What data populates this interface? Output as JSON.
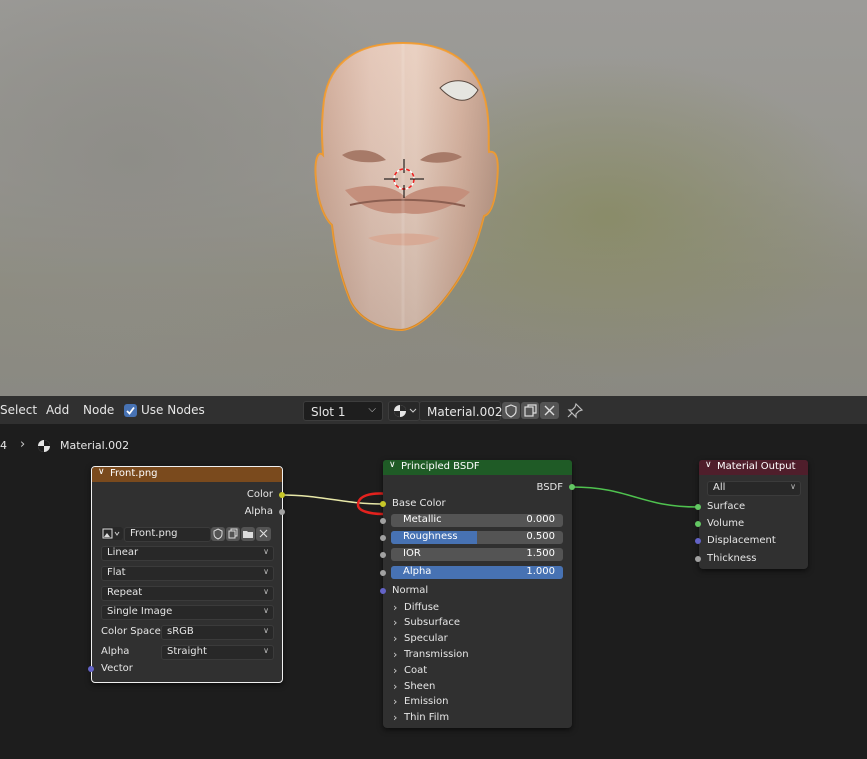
{
  "menu": {
    "select": "Select",
    "add": "Add",
    "node": "Node",
    "use_nodes": "Use Nodes"
  },
  "slot": {
    "value": "Slot 1"
  },
  "material": {
    "name": "Material.002"
  },
  "breadcrumb": {
    "prefix": "4",
    "material": "Material.002"
  },
  "image_node": {
    "title": "Front.png",
    "outputs": {
      "color": "Color",
      "alpha": "Alpha"
    },
    "image_name": "Front.png",
    "interpolation": "Linear",
    "projection": "Flat",
    "extension": "Repeat",
    "source": "Single Image",
    "color_space_label": "Color Space",
    "color_space_value": "sRGB",
    "alpha_label": "Alpha",
    "alpha_value": "Straight",
    "vector_label": "Vector"
  },
  "bsdf_node": {
    "title": "Principled BSDF",
    "output": "BSDF",
    "base_color": "Base Color",
    "metallic": {
      "label": "Metallic",
      "value": "0.000"
    },
    "roughness": {
      "label": "Roughness",
      "value": "0.500",
      "fill": 0.5
    },
    "ior": {
      "label": "IOR",
      "value": "1.500"
    },
    "alpha": {
      "label": "Alpha",
      "value": "1.000",
      "fill": 1.0
    },
    "normal": "Normal",
    "panels": [
      "Diffuse",
      "Subsurface",
      "Specular",
      "Transmission",
      "Coat",
      "Sheen",
      "Emission",
      "Thin Film"
    ]
  },
  "output_node": {
    "title": "Material Output",
    "target": "All",
    "inputs": [
      "Surface",
      "Volume",
      "Displacement",
      "Thickness"
    ]
  },
  "colors": {
    "image_header": "#7a4a1d",
    "bsdf_header": "#1f5b26",
    "output_header": "#4f1e2b",
    "socket_color": "#c7c729",
    "socket_float": "#a1a1a1",
    "socket_vector": "#6363c7",
    "socket_shader": "#63c763",
    "accent": "#4772b3",
    "annotation": "#e3221e"
  },
  "icons": [
    "checkbox-icon",
    "sphere-icon",
    "shield-icon",
    "duplicate-icon",
    "close-icon",
    "pin-icon",
    "image-icon",
    "folder-icon",
    "chevron-down-icon",
    "chevron-right-icon",
    "cursor-3d-icon"
  ]
}
